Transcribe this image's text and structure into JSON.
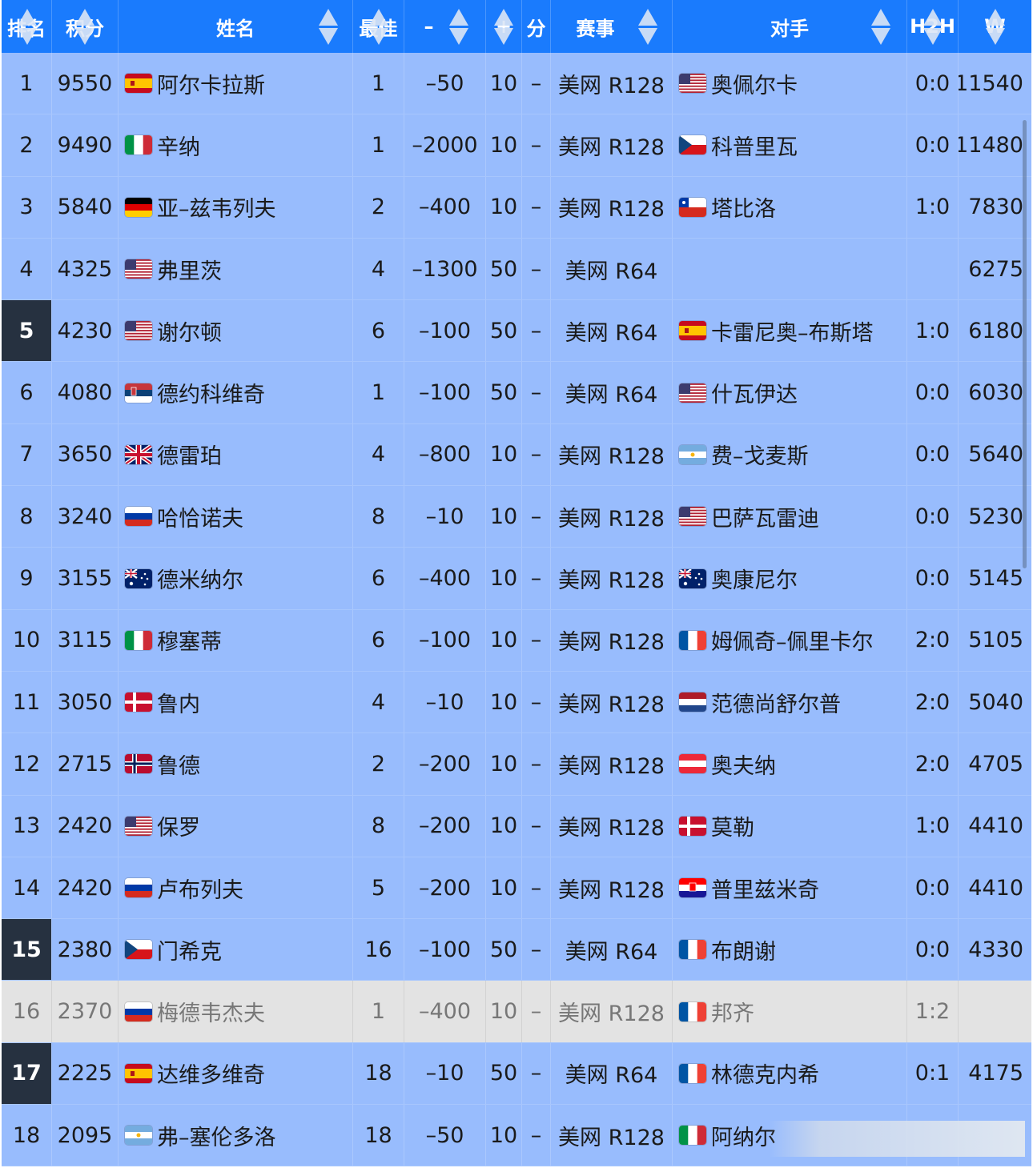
{
  "header": [
    "排名",
    "积分",
    "姓名",
    "最佳",
    "–",
    "+",
    "分",
    "赛事",
    "对手",
    "H2H",
    "W"
  ],
  "colors": {
    "header": "#1a7bfd",
    "row": "#98bcfd",
    "highlight": "#263140",
    "gray": "#e3e3e3"
  },
  "rows": [
    {
      "rank": "1",
      "points": "9550",
      "flag": "ESP",
      "name": "阿尔卡拉斯",
      "best": "1",
      "minus": "–50",
      "plus": "10",
      "fen": "–",
      "event": "美网 R128",
      "oflag": "USA",
      "opponent": "奥佩尔卡",
      "h2h": "0:0",
      "w": "11540",
      "hl": false,
      "gray": false
    },
    {
      "rank": "2",
      "points": "9490",
      "flag": "ITA",
      "name": "辛纳",
      "best": "1",
      "minus": "–2000",
      "plus": "10",
      "fen": "–",
      "event": "美网 R128",
      "oflag": "CZE",
      "opponent": "科普里瓦",
      "h2h": "0:0",
      "w": "11480",
      "hl": false,
      "gray": false
    },
    {
      "rank": "3",
      "points": "5840",
      "flag": "GER",
      "name": "亚–兹韦列夫",
      "best": "2",
      "minus": "–400",
      "plus": "10",
      "fen": "–",
      "event": "美网 R128",
      "oflag": "CHI",
      "opponent": "塔比洛",
      "h2h": "1:0",
      "w": "7830",
      "hl": false,
      "gray": false
    },
    {
      "rank": "4",
      "points": "4325",
      "flag": "USA",
      "name": "弗里茨",
      "best": "4",
      "minus": "–1300",
      "plus": "50",
      "fen": "–",
      "event": "美网 R64",
      "oflag": "",
      "opponent": "",
      "h2h": "",
      "w": "6275",
      "hl": false,
      "gray": false
    },
    {
      "rank": "5",
      "points": "4230",
      "flag": "USA",
      "name": "谢尔顿",
      "best": "6",
      "minus": "–100",
      "plus": "50",
      "fen": "–",
      "event": "美网 R64",
      "oflag": "ESP",
      "opponent": "卡雷尼奥–布斯塔",
      "h2h": "1:0",
      "w": "6180",
      "hl": true,
      "gray": false
    },
    {
      "rank": "6",
      "points": "4080",
      "flag": "SRB",
      "name": "德约科维奇",
      "best": "1",
      "minus": "–100",
      "plus": "50",
      "fen": "–",
      "event": "美网 R64",
      "oflag": "USA",
      "opponent": "什瓦伊达",
      "h2h": "0:0",
      "w": "6030",
      "hl": false,
      "gray": false
    },
    {
      "rank": "7",
      "points": "3650",
      "flag": "GBR",
      "name": "德雷珀",
      "best": "4",
      "minus": "–800",
      "plus": "10",
      "fen": "–",
      "event": "美网 R128",
      "oflag": "ARG",
      "opponent": "费–戈麦斯",
      "h2h": "0:0",
      "w": "5640",
      "hl": false,
      "gray": false
    },
    {
      "rank": "8",
      "points": "3240",
      "flag": "RUS",
      "name": "哈恰诺夫",
      "best": "8",
      "minus": "–10",
      "plus": "10",
      "fen": "–",
      "event": "美网 R128",
      "oflag": "USA",
      "opponent": "巴萨瓦雷迪",
      "h2h": "0:0",
      "w": "5230",
      "hl": false,
      "gray": false
    },
    {
      "rank": "9",
      "points": "3155",
      "flag": "AUS",
      "name": "德米纳尔",
      "best": "6",
      "minus": "–400",
      "plus": "10",
      "fen": "–",
      "event": "美网 R128",
      "oflag": "AUS",
      "opponent": "奥康尼尔",
      "h2h": "0:0",
      "w": "5145",
      "hl": false,
      "gray": false
    },
    {
      "rank": "10",
      "points": "3115",
      "flag": "ITA",
      "name": "穆塞蒂",
      "best": "6",
      "minus": "–100",
      "plus": "10",
      "fen": "–",
      "event": "美网 R128",
      "oflag": "FRA",
      "opponent": "姆佩奇–佩里卡尔",
      "h2h": "2:0",
      "w": "5105",
      "hl": false,
      "gray": false
    },
    {
      "rank": "11",
      "points": "3050",
      "flag": "DEN",
      "name": "鲁内",
      "best": "4",
      "minus": "–10",
      "plus": "10",
      "fen": "–",
      "event": "美网 R128",
      "oflag": "NED",
      "opponent": "范德尚舒尔普",
      "h2h": "2:0",
      "w": "5040",
      "hl": false,
      "gray": false
    },
    {
      "rank": "12",
      "points": "2715",
      "flag": "NOR",
      "name": "鲁德",
      "best": "2",
      "minus": "–200",
      "plus": "10",
      "fen": "–",
      "event": "美网 R128",
      "oflag": "AUT",
      "opponent": "奥夫纳",
      "h2h": "2:0",
      "w": "4705",
      "hl": false,
      "gray": false
    },
    {
      "rank": "13",
      "points": "2420",
      "flag": "USA",
      "name": "保罗",
      "best": "8",
      "minus": "–200",
      "plus": "10",
      "fen": "–",
      "event": "美网 R128",
      "oflag": "DEN",
      "opponent": "莫勒",
      "h2h": "1:0",
      "w": "4410",
      "hl": false,
      "gray": false
    },
    {
      "rank": "14",
      "points": "2420",
      "flag": "RUS",
      "name": "卢布列夫",
      "best": "5",
      "minus": "–200",
      "plus": "10",
      "fen": "–",
      "event": "美网 R128",
      "oflag": "CRO",
      "opponent": "普里兹米奇",
      "h2h": "0:0",
      "w": "4410",
      "hl": false,
      "gray": false
    },
    {
      "rank": "15",
      "points": "2380",
      "flag": "CZE",
      "name": "门希克",
      "best": "16",
      "minus": "–100",
      "plus": "50",
      "fen": "–",
      "event": "美网 R64",
      "oflag": "FRA",
      "opponent": "布朗谢",
      "h2h": "0:0",
      "w": "4330",
      "hl": true,
      "gray": false
    },
    {
      "rank": "16",
      "points": "2370",
      "flag": "RUS",
      "name": "梅德韦杰夫",
      "best": "1",
      "minus": "–400",
      "plus": "10",
      "fen": "–",
      "event": "美网 R128",
      "oflag": "FRA",
      "opponent": "邦齐",
      "h2h": "1:2",
      "w": "",
      "hl": false,
      "gray": true
    },
    {
      "rank": "17",
      "points": "2225",
      "flag": "ESP",
      "name": "达维多维奇",
      "best": "18",
      "minus": "–10",
      "plus": "50",
      "fen": "–",
      "event": "美网 R64",
      "oflag": "FRA",
      "opponent": "林德克内希",
      "h2h": "0:1",
      "w": "4175",
      "hl": true,
      "gray": false
    },
    {
      "rank": "18",
      "points": "2095",
      "flag": "ARG",
      "name": "弗–塞伦多洛",
      "best": "18",
      "minus": "–50",
      "plus": "10",
      "fen": "–",
      "event": "美网 R128",
      "oflag": "ITA",
      "opponent": "阿纳尔",
      "h2h": "",
      "w": "",
      "hl": false,
      "gray": false
    }
  ]
}
